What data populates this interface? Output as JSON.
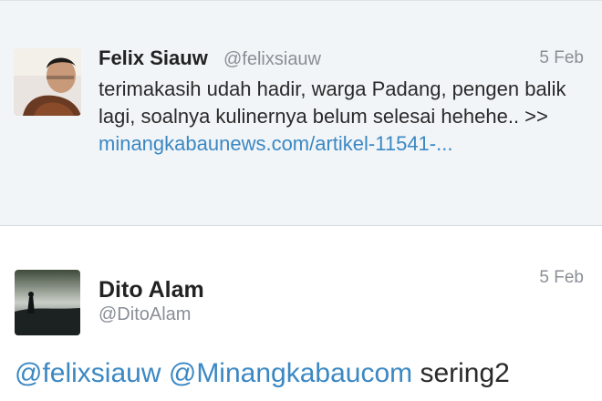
{
  "tweets": [
    {
      "name": "Felix Siauw",
      "handle": "@felixsiauw",
      "time": "5 Feb",
      "text_before_link": "terimakasih udah hadir, warga Padang, pengen balik lagi, soalnya kulinernya belum selesai hehehe.. >> ",
      "link": "minangkabaunews.com/artikel-11541-...",
      "avatar_icon": "profile-photo"
    },
    {
      "name": "Dito Alam",
      "handle": "@DitoAlam",
      "time": "5 Feb",
      "mention1": "@felixsiauw",
      "mention2": "@Minangkabaucom",
      "text_after": " sering2",
      "avatar_icon": "landscape-photo"
    }
  ],
  "colors": {
    "link": "#3b88c3",
    "muted": "#8a8f96",
    "tweet1_bg": "#f2f5f8"
  }
}
